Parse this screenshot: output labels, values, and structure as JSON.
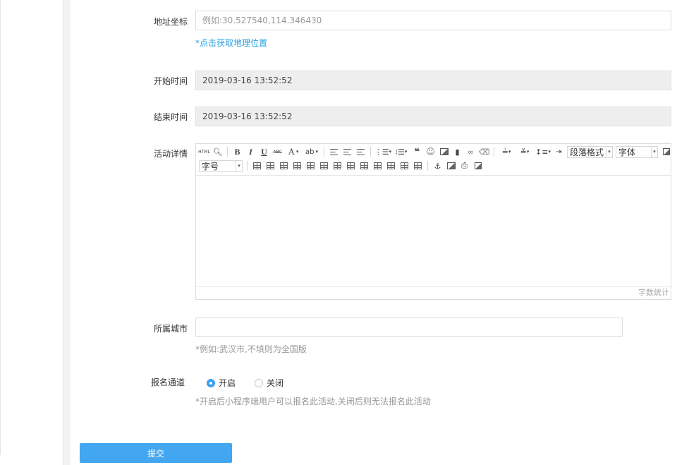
{
  "form": {
    "coords": {
      "label": "地址坐标",
      "placeholder": "例如:30.527540,114.346430",
      "link": "*点击获取地理位置"
    },
    "start_time": {
      "label": "开始时间",
      "value": "2019-03-16 13:52:52"
    },
    "end_time": {
      "label": "结束时间",
      "value": "2019-03-16 13:52:52"
    },
    "detail": {
      "label": "活动详情",
      "toolbar": {
        "html": "HTML",
        "bold": "B",
        "italic": "I",
        "underline": "U",
        "strike": "ABC",
        "font_color": "A",
        "quote": "❝",
        "paragraph": "段落格式",
        "font_family": "字体",
        "font_size": "字号"
      },
      "word_count": "字数统计"
    },
    "city": {
      "label": "所属城市",
      "value": "",
      "hint": "*例如:武汉市,不填则为全国版"
    },
    "signup": {
      "label": "报名通道",
      "options": [
        "开启",
        "关闭"
      ],
      "selected": "开启",
      "hint": "*开启后小程序端用户可以报名此活动,关闭后则无法报名此活动"
    },
    "submit_label": "提交"
  },
  "colors": {
    "accent": "#43a6f1",
    "link": "#27a1e6",
    "readonly_bg": "#eeeeee"
  }
}
